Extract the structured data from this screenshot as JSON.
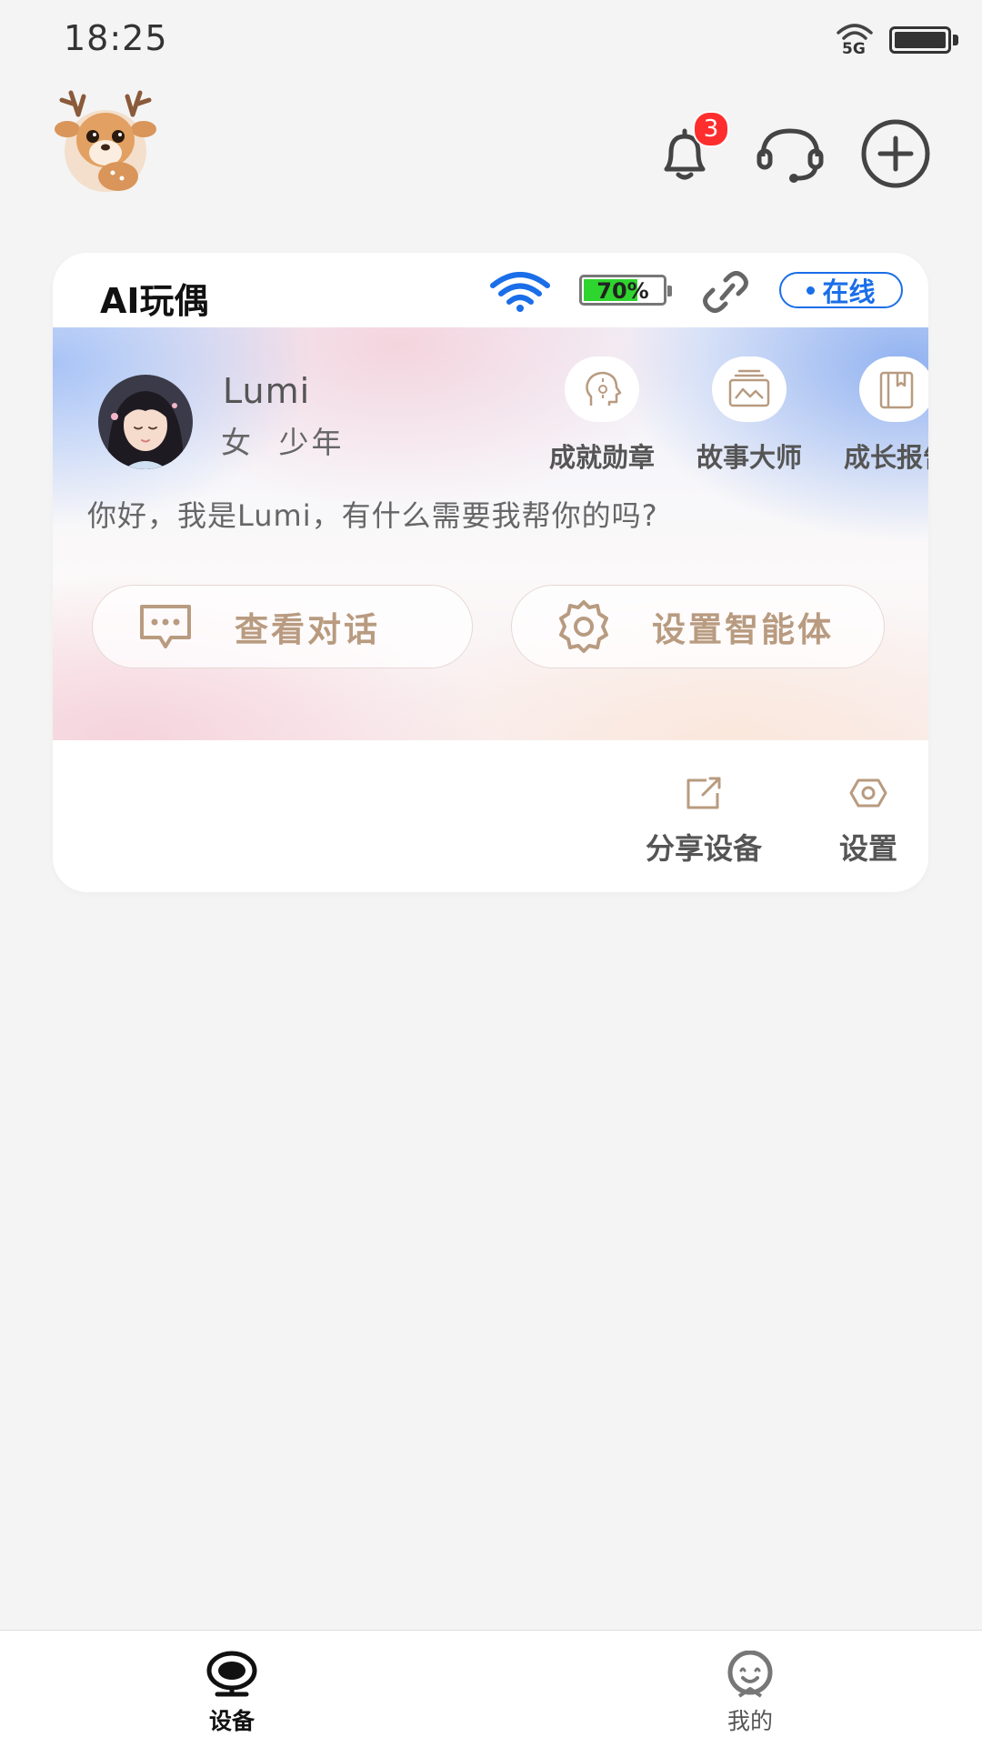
{
  "status_bar": {
    "time": "18:25",
    "network": "5G",
    "icons": [
      "signal-icon",
      "battery-icon"
    ]
  },
  "header": {
    "avatar_icon": "deer-avatar-icon",
    "notification_count": "3",
    "icons": [
      "bell-icon",
      "headset-icon",
      "plus-circle-icon"
    ]
  },
  "device_card": {
    "title": "AI玩偶",
    "battery_percent": 70,
    "battery_text": "70%",
    "status": "在线",
    "role": {
      "name": "Lumi",
      "gender": "女",
      "age_group": "少年"
    },
    "quick_actions": [
      {
        "label": "成就勋章",
        "icon": "head-medal-icon"
      },
      {
        "label": "故事大师",
        "icon": "story-book-icon"
      },
      {
        "label": "成长报告",
        "icon": "report-book-icon"
      }
    ],
    "greeting": "你好，我是Lumi，有什么需要我帮你的吗?",
    "buttons": {
      "view_chat": "查看对话",
      "agent_settings": "设置智能体"
    },
    "footer": {
      "share": "分享设备",
      "settings": "设置"
    }
  },
  "tabbar": {
    "tabs": [
      {
        "label": "设备",
        "active": true,
        "icon": "device-icon"
      },
      {
        "label": "我的",
        "active": false,
        "icon": "profile-icon"
      }
    ]
  },
  "colors": {
    "accent_blue": "#1a6ee8",
    "button_text": "#b89b80",
    "badge": "#ff2e2e",
    "battery_green": "#2ed52e"
  }
}
